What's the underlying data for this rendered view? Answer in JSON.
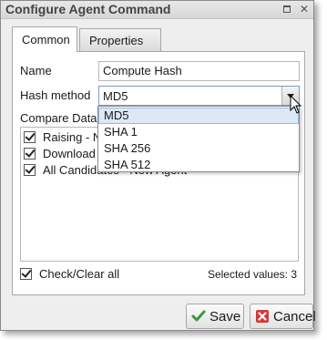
{
  "window": {
    "title": "Configure Agent Command"
  },
  "tabs": [
    {
      "label": "Common"
    },
    {
      "label": "Properties"
    }
  ],
  "form": {
    "name_label": "Name",
    "name_value": "Compute Hash",
    "hash_label": "Hash method",
    "hash_value": "MD5",
    "compare_label": "Compare Data"
  },
  "compare_items": [
    {
      "label": "Raising - N",
      "checked": true
    },
    {
      "label": "Download",
      "checked": true
    },
    {
      "label": "All Candidates - New Agent",
      "checked": true
    }
  ],
  "dropdown": {
    "options": [
      "MD5",
      "SHA 1",
      "SHA 256",
      "SHA 512"
    ],
    "selected": "MD5"
  },
  "footer": {
    "check_all_label": "Check/Clear all",
    "selected_text": "Selected values: 3"
  },
  "buttons": {
    "save_label": "Save",
    "cancel_label": "Cancel"
  },
  "colors": {
    "accent": "#7a9cc6",
    "save_icon": "#3a9a3a",
    "cancel_icon": "#d03a3a"
  }
}
